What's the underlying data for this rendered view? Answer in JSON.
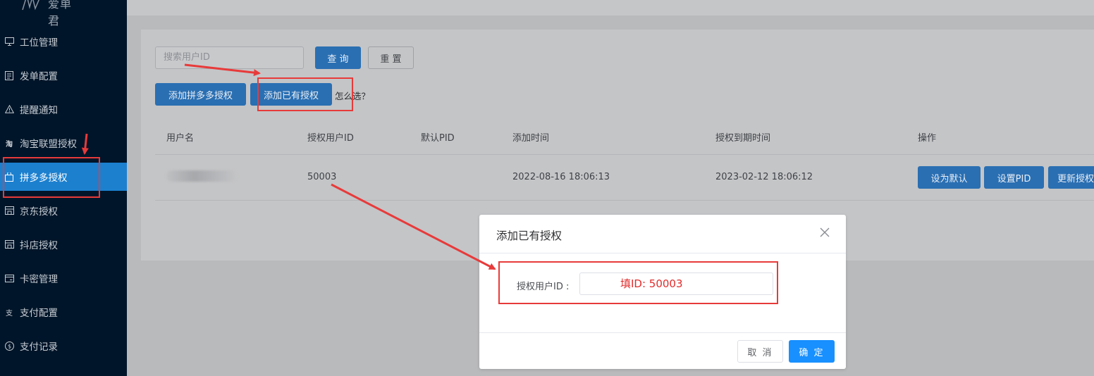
{
  "colors": {
    "sidebar_bg": "#001529",
    "sidebar_active": "#1c80cf",
    "primary": "#1890ff",
    "annotation_red": "#e83a3a"
  },
  "logo": {
    "text": "爱单君"
  },
  "sidebar": {
    "items": [
      {
        "label": "工位管理",
        "icon": "monitor-icon"
      },
      {
        "label": "发单配置",
        "icon": "document-icon"
      },
      {
        "label": "提醒通知",
        "icon": "warning-icon"
      },
      {
        "label": "淘宝联盟授权",
        "icon": "taobao-icon"
      },
      {
        "label": "拼多多授权",
        "icon": "bag-icon",
        "active": true
      },
      {
        "label": "京东授权",
        "icon": "store-icon"
      },
      {
        "label": "抖店授权",
        "icon": "store-icon"
      },
      {
        "label": "卡密管理",
        "icon": "card-icon"
      },
      {
        "label": "支付配置",
        "icon": "payment-icon"
      },
      {
        "label": "支付记录",
        "icon": "dollar-icon"
      }
    ]
  },
  "search": {
    "placeholder": "搜索用户ID",
    "query_label": "查 询",
    "reset_label": "重 置"
  },
  "actions": {
    "add_pdd_label": "添加拼多多授权",
    "add_existing_label": "添加已有授权",
    "help_text": "怎么选？"
  },
  "table": {
    "headers": [
      "用户名",
      "授权用户ID",
      "默认PID",
      "添加时间",
      "授权到期时间",
      "操作"
    ],
    "rows": [
      {
        "user_id": "50003",
        "pid": "",
        "added": "2022-08-16 18:06:13",
        "expires": "2023-02-12 18:06:12",
        "ops": [
          "设为默认",
          "设置PID",
          "更新授权"
        ]
      }
    ]
  },
  "dialog": {
    "title": "添加已有授权",
    "field_label": "授权用户ID :",
    "field_value": "填ID: 50003",
    "cancel_label": "取 消",
    "confirm_label": "确 定"
  }
}
